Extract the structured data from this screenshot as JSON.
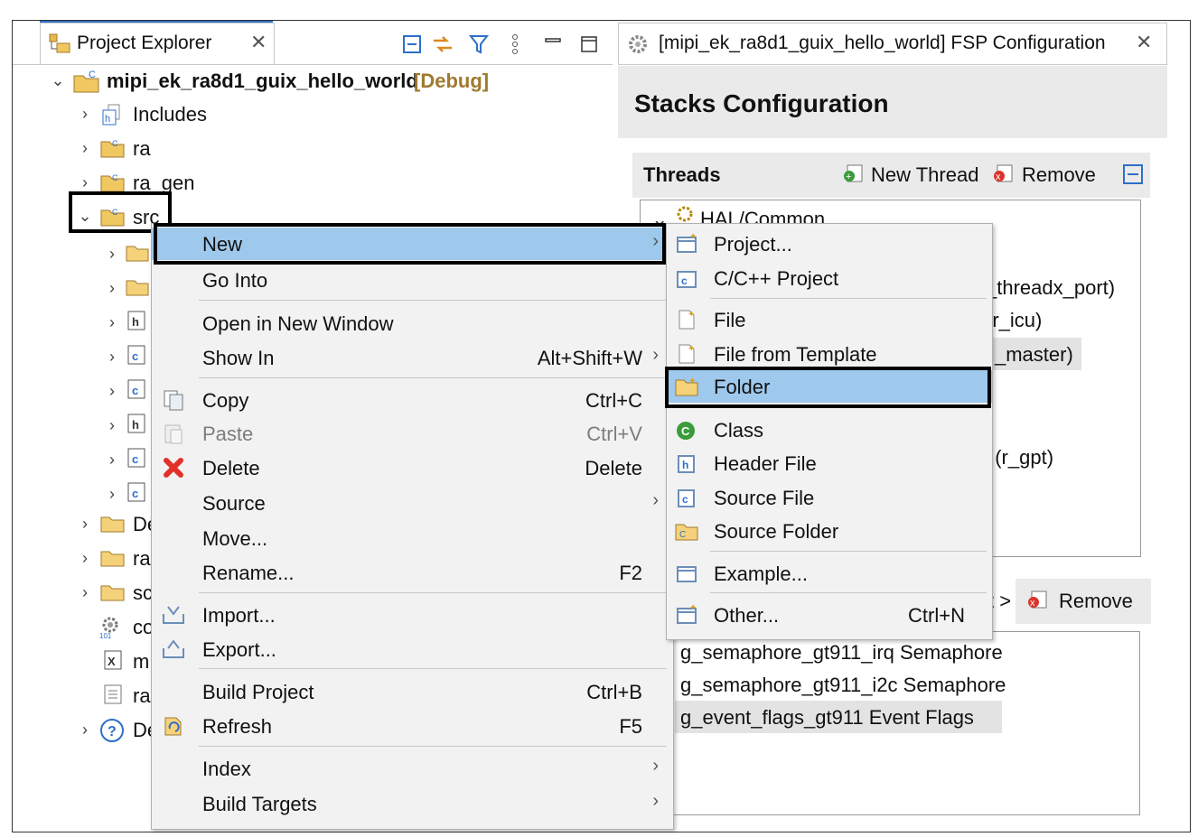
{
  "project_explorer": {
    "tab_title": "Project Explorer",
    "project": {
      "name": "mipi_ek_ra8d1_guix_hello_world",
      "config": "[Debug]"
    },
    "tree": [
      {
        "label": "Includes"
      },
      {
        "label": "ra"
      },
      {
        "label": "ra_gen"
      },
      {
        "label": "src"
      }
    ],
    "partial_rows": [
      "De",
      "ra",
      "sc",
      "co",
      "m",
      "ra",
      "De"
    ]
  },
  "fsp": {
    "tab_title": "[mipi_ek_ra8d1_guix_hello_world] FSP Configuration",
    "heading": "Stacks Configuration",
    "threads_label": "Threads",
    "new_thread": "New Thread",
    "remove": "Remove",
    "hal_common": "HAL/Common",
    "partial_items": [
      "_threadx_port)",
      "(r_icu)",
      "_master)",
      "/ (r_gpt)"
    ],
    "objects_partial": "t >",
    "objects_remove": "Remove",
    "objects": [
      "g_semaphore_gt911_irq Semaphore",
      "g_semaphore_gt911_i2c Semaphore",
      "g_event_flags_gt911 Event Flags"
    ]
  },
  "context_menu": {
    "new": "New",
    "go_into": "Go Into",
    "open_new_window": "Open in New Window",
    "show_in": "Show In",
    "show_in_key": "Alt+Shift+W",
    "copy": "Copy",
    "copy_key": "Ctrl+C",
    "paste": "Paste",
    "paste_key": "Ctrl+V",
    "delete": "Delete",
    "delete_key": "Delete",
    "source": "Source",
    "move": "Move...",
    "rename": "Rename...",
    "rename_key": "F2",
    "import": "Import...",
    "export": "Export...",
    "build_project": "Build Project",
    "build_project_key": "Ctrl+B",
    "refresh": "Refresh",
    "refresh_key": "F5",
    "index": "Index",
    "build_targets": "Build Targets"
  },
  "new_submenu": {
    "project": "Project...",
    "cpp_project": "C/C++ Project",
    "file": "File",
    "file_from_template": "File from Template",
    "folder": "Folder",
    "class": "Class",
    "header_file": "Header File",
    "source_file": "Source File",
    "source_folder": "Source Folder",
    "example": "Example...",
    "other": "Other...",
    "other_key": "Ctrl+N"
  },
  "colors": {
    "highlight": "#9ec9ec",
    "debug": "#a07a2e",
    "accent_tab": "#2f6fc9"
  }
}
